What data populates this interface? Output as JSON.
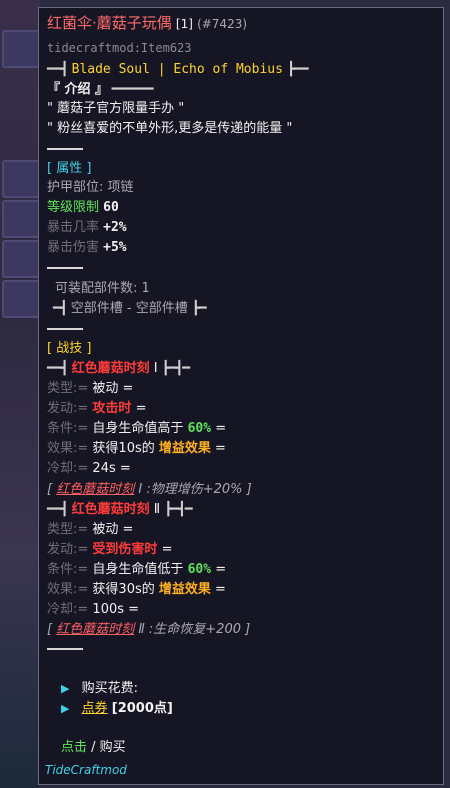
{
  "item": {
    "name": "红菌伞·蘑菇子玩偶",
    "count": "[1]",
    "id": "(#7423)",
    "internal_name": "tidecraftmod:Item623",
    "mod_banner": "Blade Soul | Echo of Mobius"
  },
  "intro": {
    "header": "『 介绍 』",
    "lines": [
      "\" 蘑菇子官方限量手办 \"",
      "\" 粉丝喜爱的不单外形,更多是传递的能量 \""
    ]
  },
  "attributes": {
    "header": "[ 属性 ]",
    "slot_label": "护甲部位:",
    "slot_value": "项链",
    "level_label": "等级限制",
    "level_value": "60",
    "crit_rate_label": "暴击几率",
    "crit_rate_value": "+2%",
    "crit_dmg_label": "暴击伤害",
    "crit_dmg_value": "+5%"
  },
  "parts": {
    "count_label": "可装配部件数:",
    "count_value": "1",
    "slot_text": "空部件槽 - 空部件槽"
  },
  "skills": {
    "header": "[ 战技 ]",
    "list": [
      {
        "name": "红色蘑菇时刻",
        "numeral": "Ⅰ",
        "type_label": "类型:=",
        "type_value": "被动 =",
        "trigger_label": "发动:=",
        "trigger_value": "攻击时",
        "trigger_tail": "=",
        "cond_label": "条件:=",
        "cond_prefix": "自身生命值高于",
        "cond_value": "60%",
        "cond_tail": "=",
        "effect_label": "效果:=",
        "effect_prefix": "获得10s的",
        "effect_value": "增益效果",
        "effect_tail": "=",
        "cd_label": "冷却:=",
        "cd_value": "24s =",
        "summary_name": "红色蘑菇时刻",
        "summary_text": "Ⅰ :物理增伤+20% ]"
      },
      {
        "name": "红色蘑菇时刻",
        "numeral": "Ⅱ",
        "type_label": "类型:=",
        "type_value": "被动 =",
        "trigger_label": "发动:=",
        "trigger_value": "受到伤害时",
        "trigger_tail": "=",
        "cond_label": "条件:=",
        "cond_prefix": "自身生命值低于",
        "cond_value": "60%",
        "cond_tail": "=",
        "effect_label": "效果:=",
        "effect_prefix": "获得30s的",
        "effect_value": "增益效果",
        "effect_tail": "=",
        "cd_label": "冷却:=",
        "cd_value": "100s =",
        "summary_name": "红色蘑菇时刻",
        "summary_text": "Ⅱ :生命恢复+200 ]"
      }
    ]
  },
  "purchase": {
    "cost_label": "购买花费:",
    "currency": "点券",
    "amount": "[2000点]",
    "action_click": "点击",
    "action_buy": "/ 购买",
    "mod_name": "TideCraftmod"
  },
  "colors": {
    "title": "#ff6b6b",
    "cyan": "#3fd1e6",
    "green": "#5fe35a",
    "yellow": "#ffd52b",
    "red": "#ff3b3b"
  }
}
